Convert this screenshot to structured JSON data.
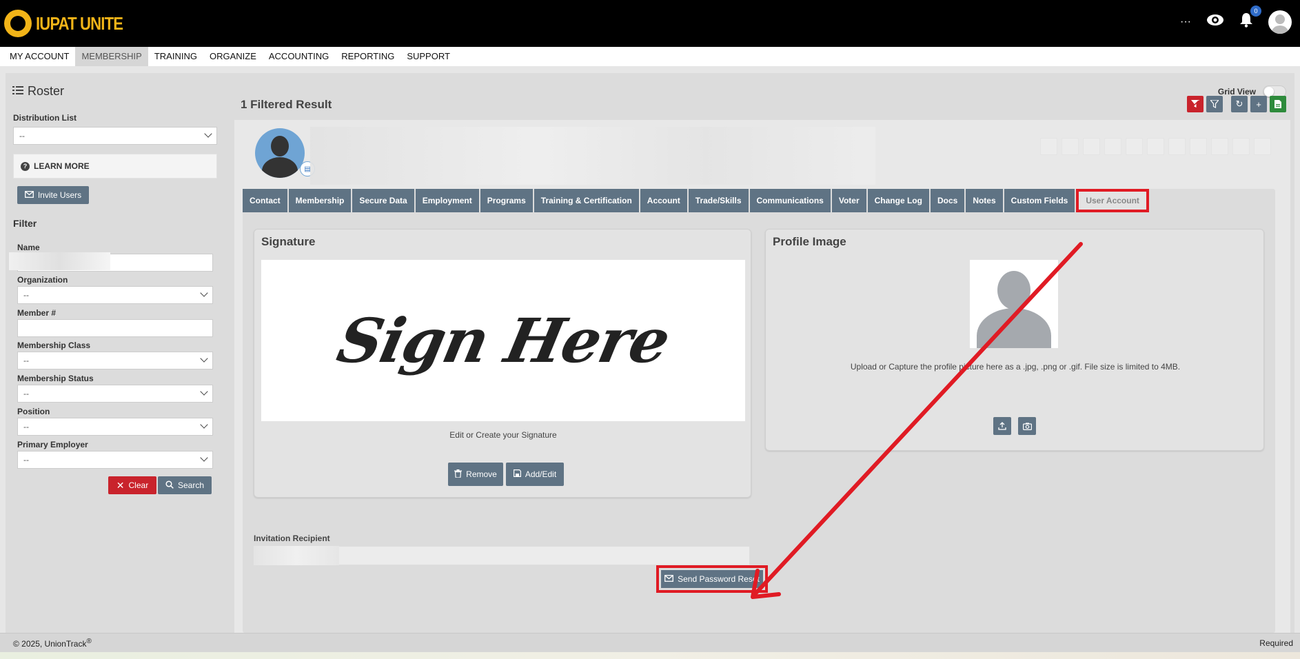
{
  "app": {
    "logo_text": "IUPAT UNITE",
    "notification_count": "0"
  },
  "menu": [
    {
      "label": "MY ACCOUNT"
    },
    {
      "label": "MEMBERSHIP"
    },
    {
      "label": "TRAINING"
    },
    {
      "label": "ORGANIZE"
    },
    {
      "label": "ACCOUNTING"
    },
    {
      "label": "REPORTING"
    },
    {
      "label": "SUPPORT"
    }
  ],
  "page": {
    "title": "Roster",
    "grid_view_label": "Grid View",
    "results_label": "1 Filtered Result"
  },
  "sidebar": {
    "distribution_list_label": "Distribution List",
    "distribution_list_value": "--",
    "learn_more": "LEARN MORE",
    "invite_users": "Invite Users",
    "filter_heading": "Filter",
    "fields": {
      "name": "Name",
      "organization": "Organization",
      "organization_value": "--",
      "member_no": "Member #",
      "membership_class": "Membership Class",
      "membership_class_value": "--",
      "membership_status": "Membership Status",
      "membership_status_value": "--",
      "position": "Position",
      "position_value": "--",
      "primary_employer": "Primary Employer",
      "primary_employer_value": "--"
    },
    "clear": "Clear",
    "search": "Search"
  },
  "tabs": [
    {
      "label": "Contact"
    },
    {
      "label": "Membership"
    },
    {
      "label": "Secure Data"
    },
    {
      "label": "Employment"
    },
    {
      "label": "Programs"
    },
    {
      "label": "Training & Certification"
    },
    {
      "label": "Account"
    },
    {
      "label": "Trade/Skills"
    },
    {
      "label": "Communications"
    },
    {
      "label": "Voter"
    },
    {
      "label": "Change Log"
    },
    {
      "label": "Docs"
    },
    {
      "label": "Notes"
    },
    {
      "label": "Custom Fields"
    },
    {
      "label": "User Account"
    }
  ],
  "signature": {
    "heading": "Signature",
    "placeholder_text": "Sign Here",
    "caption": "Edit or Create your Signature",
    "remove": "Remove",
    "add_edit": "Add/Edit"
  },
  "profile_image": {
    "heading": "Profile Image",
    "help": "Upload or Capture the profile picture here as a .jpg, .png or .gif. File size is limited to 4MB."
  },
  "invitation": {
    "label": "Invitation Recipient",
    "send_reset": "Send Password Reset"
  },
  "footer": {
    "copyright": "© 2025, UnionTrack",
    "reg": "®",
    "required": "Required"
  },
  "colors": {
    "slate": "#5f7384",
    "red": "#c9232c",
    "highlight": "#e01b24",
    "gold": "#f2b418"
  }
}
